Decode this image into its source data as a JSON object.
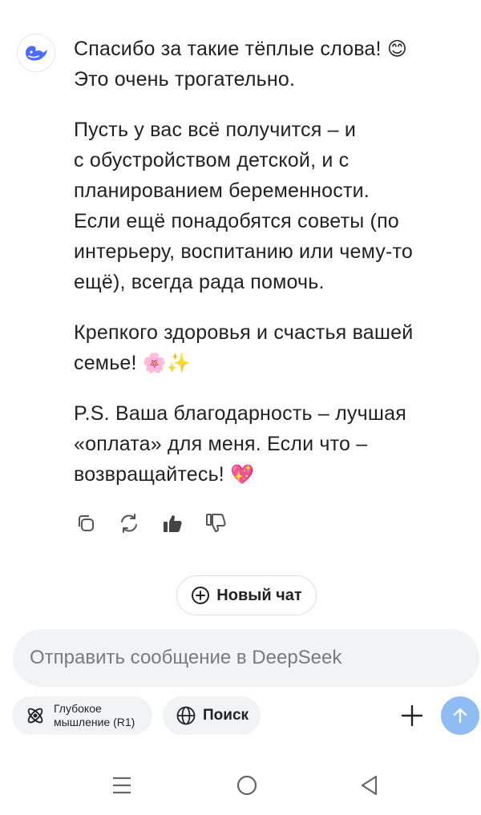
{
  "assistant": {
    "avatar_icon": "deepseek-whale-icon",
    "paragraphs": [
      {
        "lines": [
          "Спасибо за такие тёплые слова! ",
          "Это очень трогательно."
        ],
        "emoji": "😊",
        "emoji_line": 0
      },
      {
        "lines": [
          "Пусть у вас всё получится – и",
          "с обустройством детской, и с",
          "планированием беременности.",
          "Если ещё понадобятся советы (по",
          "интерьеру, воспитанию или чему-то",
          "ещё), всегда рада помочь."
        ]
      },
      {
        "lines": [
          "Крепкого здоровья и счастья вашей",
          "семье! "
        ],
        "emoji": "🌸✨",
        "emoji_line": 1
      },
      {
        "lines": [
          "P.S. Ваша благодарность – лучшая",
          "«оплата» для меня. Если что –",
          "возвращайтесь! "
        ],
        "emoji": "💖",
        "emoji_line": 2
      }
    ],
    "actions": [
      "copy-icon",
      "regenerate-icon",
      "thumbs-up-icon",
      "thumbs-down-icon"
    ]
  },
  "new_chat": {
    "label": "Новый чат",
    "icon": "plus-circle-icon"
  },
  "composer": {
    "placeholder": "Отправить сообщение в DeepSeek",
    "deep_think": {
      "line1": "Глубокое",
      "line2": "мышление (R1)",
      "icon": "atom-icon"
    },
    "search": {
      "label": "Поиск",
      "icon": "globe-icon"
    },
    "attach_icon": "plus-icon",
    "send_icon": "arrow-up-icon"
  },
  "system_nav": [
    "menu-icon",
    "home-icon",
    "back-icon"
  ],
  "colors": {
    "send_button": "#8fbcf3",
    "chip_bg": "#f2f3f5",
    "avatar_blue": "#4d6bfe"
  }
}
